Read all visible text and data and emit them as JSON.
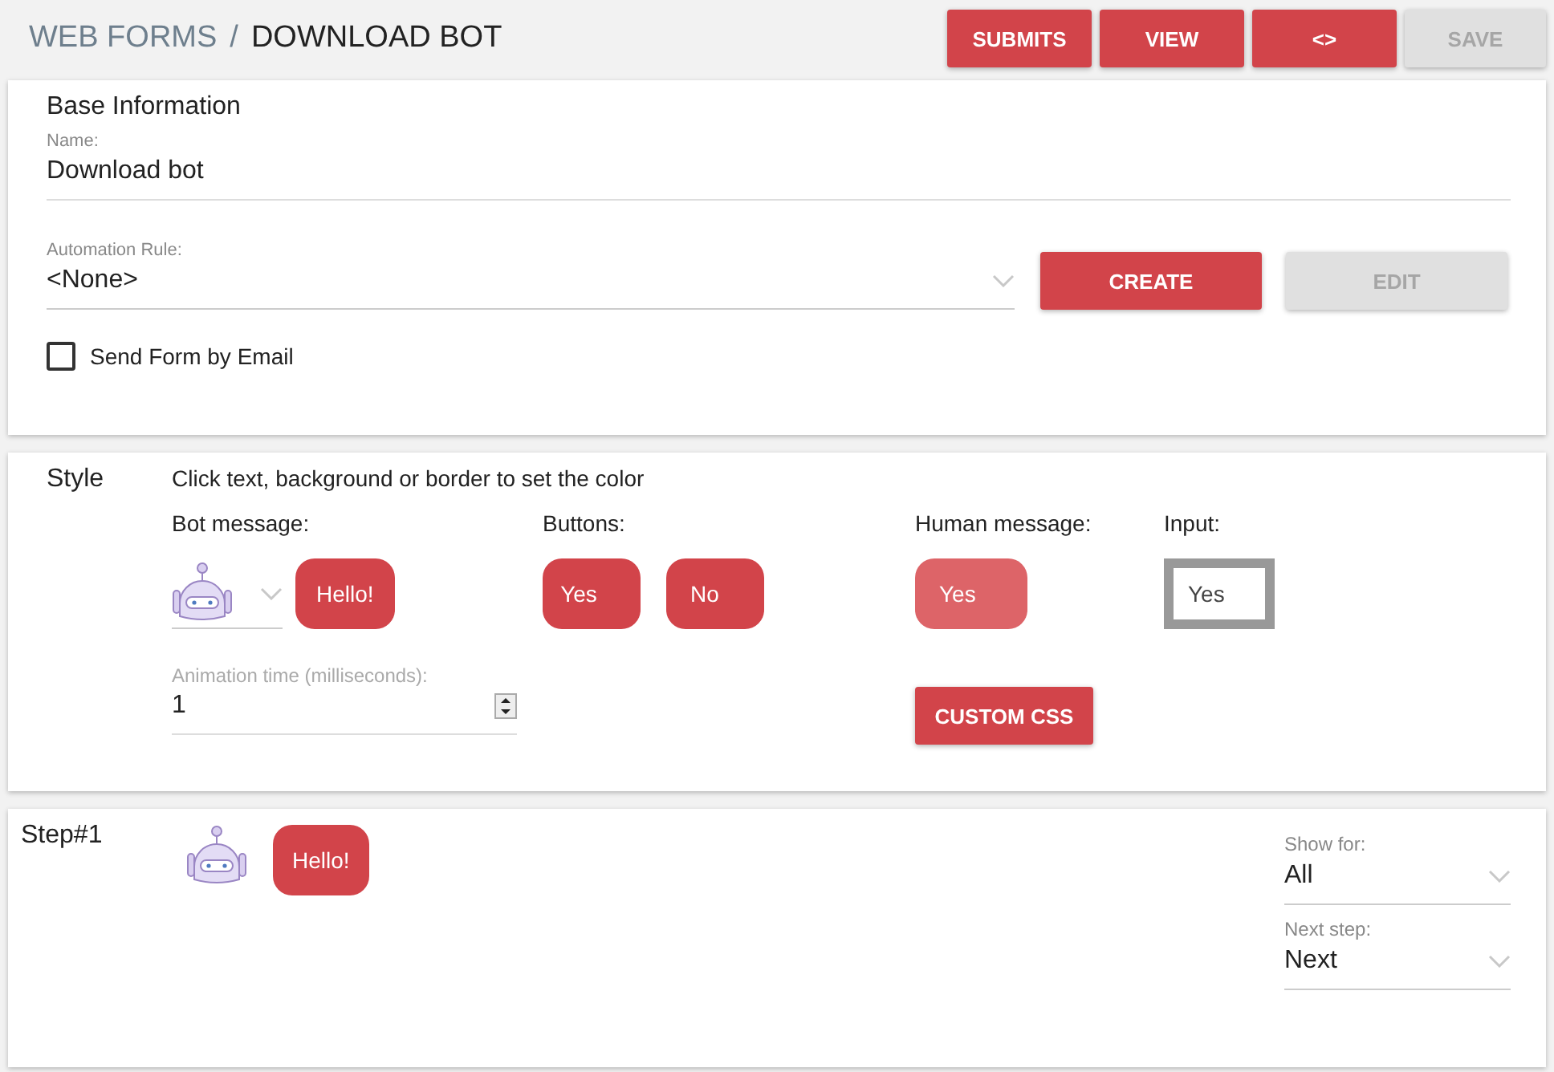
{
  "breadcrumb": {
    "parent": "WEB FORMS",
    "separator": "/",
    "current": "DOWNLOAD BOT"
  },
  "toolbar": [
    {
      "label": "SUBMITS",
      "disabled": false
    },
    {
      "label": "VIEW",
      "disabled": false
    },
    {
      "label": "<>",
      "disabled": false
    },
    {
      "label": "SAVE",
      "disabled": true
    }
  ],
  "base_information": {
    "title": "Base Information",
    "name_label": "Name:",
    "name_value": "Download bot",
    "rule_label": "Automation Rule:",
    "rule_value": "<None>",
    "rule_buttons": [
      {
        "label": "CREATE",
        "disabled": false
      },
      {
        "label": "EDIT",
        "disabled": true
      }
    ],
    "email_checkbox": {
      "label": "Send Form by Email",
      "checked": false
    }
  },
  "style": {
    "title": "Style",
    "hint": "Click text, background or border to set the color",
    "bot_label": "Bot message:",
    "bot_bubble": "Hello!",
    "buttons_label": "Buttons:",
    "buttons": [
      "Yes",
      "No"
    ],
    "human_label": "Human message:",
    "human_bubble": "Yes",
    "input_label": "Input:",
    "input_value": "Yes",
    "animation_label": "Animation time (milliseconds):",
    "animation_value": "1",
    "custom_css": "CUSTOM CSS"
  },
  "step": {
    "title": "Step#1",
    "bubble": "Hello!",
    "show_for_label": "Show for:",
    "show_for_value": "All",
    "next_label": "Next step:",
    "next_value": "Next"
  }
}
